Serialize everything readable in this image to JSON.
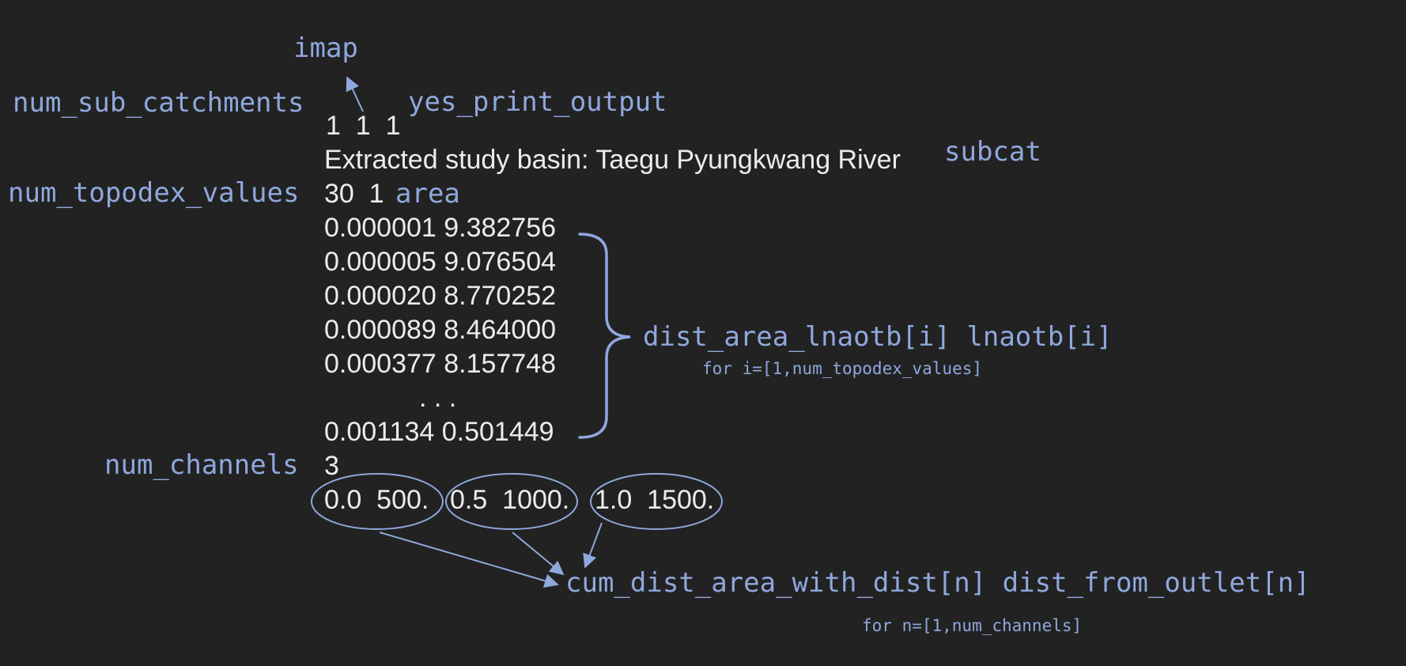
{
  "labels": {
    "imap": "imap",
    "num_sub_catchments": "num_sub_catchments",
    "yes_print_output": "yes_print_output",
    "subcat": "subcat",
    "num_topodex_values": "num_topodex_values",
    "area": "area",
    "dist_area_lnaotb": "dist_area_lnaotb[i] lnaotb[i]",
    "for_i": "for i=[1,num_topodex_values]",
    "num_channels": "num_channels",
    "cum_dist": "cum_dist_area_with_dist[n] dist_from_outlet[n]",
    "for_n": "for n=[1,num_channels]"
  },
  "file": {
    "line1": "1  1  1",
    "title": "Extracted study basin: Taegu Pyungkwang River",
    "line3": "30  1",
    "rows": [
      "0.000001 9.382756",
      "0.000005 9.076504",
      "0.000020 8.770252",
      "0.000089 8.464000",
      "0.000377 8.157748",
      "0.001134 0.501449"
    ],
    "ellipsis": ". . .",
    "num_channels_value": "3",
    "channels": [
      "0.0  500.",
      "0.5  1000.",
      "1.0  1500."
    ]
  },
  "colors": {
    "background": "#222222",
    "label": "#8fa8dd",
    "value": "#ececec",
    "lines": "#8fa8dd"
  }
}
